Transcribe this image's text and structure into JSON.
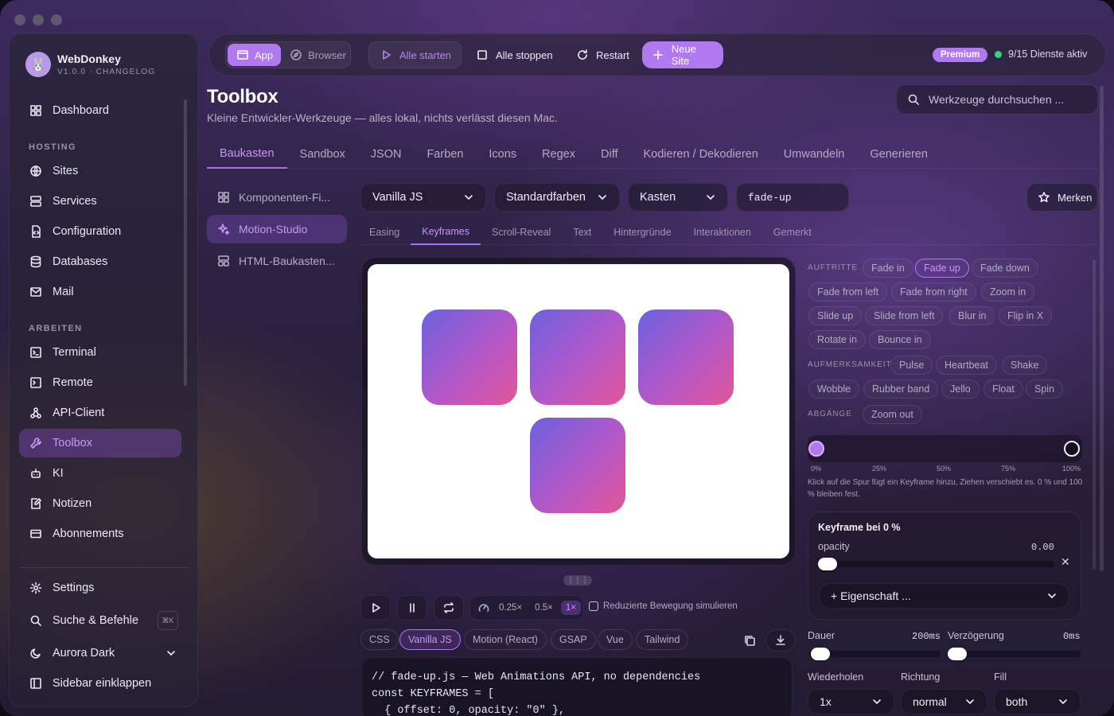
{
  "app": {
    "name": "WebDonkey",
    "version": "V1.0.0 · CHANGELOG"
  },
  "sidebar": {
    "dashboard": "Dashboard",
    "hosting_label": "HOSTING",
    "hosting": [
      "Sites",
      "Services",
      "Configuration",
      "Databases",
      "Mail"
    ],
    "arbeiten_label": "ARBEITEN",
    "arbeiten": [
      "Terminal",
      "Remote",
      "API-Client",
      "Toolbox",
      "KI",
      "Notizen",
      "Abonnements"
    ],
    "settings": "Settings",
    "search": "Suche & Befehle",
    "search_kbd": "⌘K",
    "theme": "Aurora Dark",
    "collapse": "Sidebar einklappen"
  },
  "toolbar": {
    "app": "App",
    "browser": "Browser",
    "start_all": "Alle starten",
    "stop_all": "Alle stoppen",
    "restart": "Restart",
    "new_site": "Neue Site",
    "premium": "Premium",
    "services_status": "9/15 Dienste aktiv"
  },
  "page": {
    "title": "Toolbox",
    "subtitle": "Kleine Entwickler-Werkzeuge — alles lokal, nichts verlässt diesen Mac.",
    "search_placeholder": "Werkzeuge durchsuchen ..."
  },
  "tabs": [
    "Baukasten",
    "Sandbox",
    "JSON",
    "Farben",
    "Icons",
    "Regex",
    "Diff",
    "Kodieren / Dekodieren",
    "Umwandeln",
    "Generieren"
  ],
  "tools": [
    "Komponenten-Fi...",
    "Motion-Studio",
    "HTML-Baukasten..."
  ],
  "options": {
    "framework": "Vanilla JS",
    "colors": "Standardfarben",
    "shape": "Kasten",
    "name": "fade-up",
    "save": "Merken"
  },
  "subtabs": [
    "Easing",
    "Keyframes",
    "Scroll-Reveal",
    "Text",
    "Hintergründe",
    "Interaktionen",
    "Gemerkt"
  ],
  "playback": {
    "speeds": [
      "0.25×",
      "0.5×",
      "1×"
    ],
    "reduced_motion": "Reduzierte Bewegung simulieren"
  },
  "frameworks": [
    "CSS",
    "Vanilla JS",
    "Motion (React)",
    "GSAP",
    "Vue",
    "Tailwind"
  ],
  "code": [
    "// fade-up.js — Web Animations API, no dependencies",
    "const KEYFRAMES = [",
    "  { offset: 0, opacity: \"0\" },"
  ],
  "presets": {
    "auftritte_label": "AUFTRITTE",
    "auftritte": [
      "Fade in",
      "Fade up",
      "Fade down",
      "Fade from left",
      "Fade from right",
      "Zoom in",
      "Slide up",
      "Slide from left",
      "Blur in",
      "Flip in X",
      "Rotate in",
      "Bounce in"
    ],
    "aufmerksamkeit_label": "AUFMERKSAMKEIT",
    "aufmerksamkeit": [
      "Pulse",
      "Heartbeat",
      "Shake",
      "Wobble",
      "Rubber band",
      "Jello",
      "Float",
      "Spin"
    ],
    "abgaenge_label": "ABGÄNGE",
    "abgaenge": [
      "Zoom out"
    ]
  },
  "timeline": {
    "ticks": [
      "0%",
      "25%",
      "50%",
      "75%",
      "100%"
    ],
    "hint": "Klick auf die Spur fügt ein Keyframe hinzu, Ziehen verschiebt es. 0 % und 100 % bleiben fest."
  },
  "keyframe": {
    "title": "Keyframe bei 0 %",
    "prop": "opacity",
    "value": "0.00",
    "add": "+ Eigenschaft ..."
  },
  "timing": {
    "duration_label": "Dauer",
    "duration": "200ms",
    "delay_label": "Verzögerung",
    "delay": "0ms",
    "repeat_label": "Wiederholen",
    "repeat": "1x",
    "direction_label": "Richtung",
    "direction": "normal",
    "fill_label": "Fill",
    "fill": "both"
  },
  "colors": {
    "accent": "#b079f0",
    "status": "#3ccf7e"
  }
}
